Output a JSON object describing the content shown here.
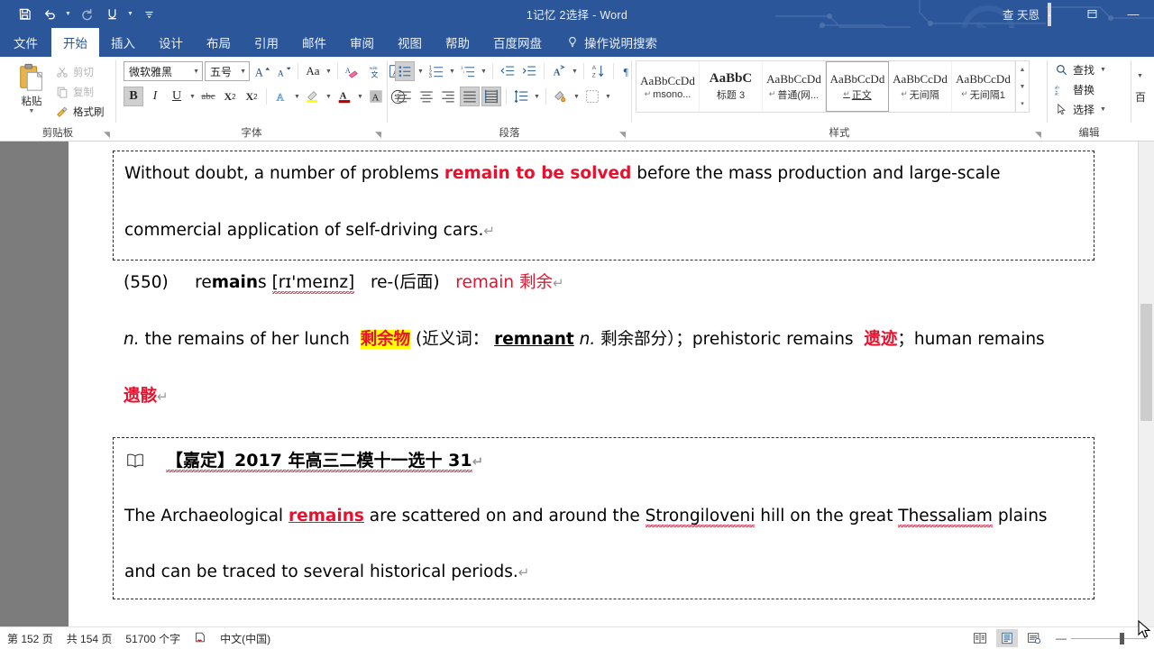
{
  "titlebar": {
    "document_title": "1记忆 2选择  -  Word",
    "account_name": "查 天恩",
    "quick_access": [
      {
        "name": "save",
        "icon": "save-icon"
      },
      {
        "name": "undo",
        "icon": "undo-icon"
      },
      {
        "name": "redo",
        "icon": "redo-icon"
      },
      {
        "name": "underline",
        "icon": "underline-icon"
      },
      {
        "name": "customize",
        "icon": "customize-toolbar-icon"
      }
    ],
    "window_controls": {
      "ribbon_display": "⊡",
      "minimize": "—"
    }
  },
  "tabs": [
    {
      "label": "文件",
      "active": false
    },
    {
      "label": "开始",
      "active": true
    },
    {
      "label": "插入",
      "active": false
    },
    {
      "label": "设计",
      "active": false
    },
    {
      "label": "布局",
      "active": false
    },
    {
      "label": "引用",
      "active": false
    },
    {
      "label": "邮件",
      "active": false
    },
    {
      "label": "审阅",
      "active": false
    },
    {
      "label": "视图",
      "active": false
    },
    {
      "label": "帮助",
      "active": false
    },
    {
      "label": "百度网盘",
      "active": false
    }
  ],
  "tell_me": "操作说明搜索",
  "ribbon": {
    "clipboard": {
      "label": "剪贴板",
      "paste": "粘贴",
      "cut": "剪切",
      "copy": "复制",
      "format_painter": "格式刷"
    },
    "font": {
      "label": "字体",
      "font_name": "微软雅黑",
      "font_size": "五号",
      "grow": "A",
      "shrink": "A",
      "change_case": "Aa",
      "clear_format": "clear-formatting-icon",
      "phonetic": "拼音指南",
      "char_border": "A",
      "bold": "B",
      "italic": "I",
      "underline": "U",
      "strikethrough": "abc",
      "subscript": "X",
      "superscript": "X",
      "text_effects": "A",
      "highlight": "highlight-icon",
      "font_color": "A",
      "shading_char": "A",
      "enclose_char": "字"
    },
    "paragraph": {
      "label": "段落",
      "bullets": "bullet-list-icon",
      "numbering": "numbered-list-icon",
      "multilevel": "multilevel-list-icon",
      "decrease_indent": "decrease-indent-icon",
      "increase_indent": "increase-indent-icon",
      "asian_layout": "asian-layout-icon",
      "sort": "sort-icon",
      "show_marks": "show-formatting-marks-icon",
      "align_left": "align-left-icon",
      "align_center": "align-center-icon",
      "align_right": "align-right-icon",
      "justify": "justify-icon",
      "distribute": "distribute-icon",
      "line_spacing": "line-spacing-icon",
      "shading": "shading-icon",
      "borders": "borders-icon"
    },
    "styles": {
      "label": "样式",
      "items": [
        {
          "preview": "AaBbCcDd",
          "name": "msono...",
          "bold": false,
          "selected": false,
          "pilcrow": true
        },
        {
          "preview": "AaBbC",
          "name": "标题 3",
          "bold": true,
          "selected": false,
          "pilcrow": false
        },
        {
          "preview": "AaBbCcDd",
          "name": "普通(网...",
          "bold": false,
          "selected": false,
          "pilcrow": true
        },
        {
          "preview": "AaBbCcDd",
          "name": "正文",
          "bold": false,
          "selected": true,
          "pilcrow": true
        },
        {
          "preview": "AaBbCcDd",
          "name": "无间隔",
          "bold": false,
          "selected": false,
          "pilcrow": true
        },
        {
          "preview": "AaBbCcDd",
          "name": "无间隔1",
          "bold": false,
          "selected": false,
          "pilcrow": true
        }
      ]
    },
    "editing": {
      "label": "编辑",
      "find": "查找",
      "replace": "替换",
      "select": "选择"
    },
    "partial_right": "百"
  },
  "document": {
    "block1": {
      "line1_a": "Without  doubt,  a  number  of  problems  ",
      "line1_red": "remain  to  be  solved",
      "line1_b": "  before  the  mass  production  and  large-scale",
      "line2": "commercial  application  of  self-driving  cars.",
      "pilcrow": "↵"
    },
    "entry": {
      "number": "(550)",
      "word_pre": "re",
      "word_bold": "main",
      "word_post": "s",
      "phonetic": "[rɪ'meɪnz]",
      "prefix_note": "re-(后面)",
      "root": "remain",
      "meaning": "剩余",
      "pilcrow": "↵"
    },
    "definition": {
      "pos": "n.",
      "seg1": "the remains of her lunch",
      "gloss1": "剩余物",
      "seg2": "(近义词：",
      "synonym": "remnant",
      "syn_pos": "n.",
      "syn_gloss": "剩余部分）；",
      "seg3": "prehistoric remains",
      "gloss2": "遗迹",
      "seg4": "；human remains",
      "gloss3": "遗骸",
      "pilcrow": "↵"
    },
    "example": {
      "source_icon": "book-icon",
      "source": "【嘉定】2017 年高三二模十一选十 31",
      "source_pilcrow": "↵",
      "sent_a": "The Archaeological ",
      "sent_key": "remains",
      "sent_b": " are scattered on and around the ",
      "sent_sp1": "Strongiloveni",
      "sent_c": " hill on the great ",
      "sent_sp2": "Thessaliam",
      "sent_d": " plains",
      "sent_line2": "and can be traced to several historical periods.",
      "pilcrow": "↵"
    }
  },
  "statusbar": {
    "page": "第 152 页",
    "total": "共 154 页",
    "words": "51700 个字",
    "proofing_icon": "proofing-errors-icon",
    "language": "中文(中国)",
    "views": [
      {
        "name": "read-mode",
        "active": false
      },
      {
        "name": "print-layout",
        "active": true
      },
      {
        "name": "web-layout",
        "active": false
      }
    ],
    "zoom_minus": "—",
    "zoom_plus": ""
  },
  "colors": {
    "brand": "#2b579a",
    "accent_red": "#e8112d",
    "highlight": "#ffff00",
    "doc_bg": "#7c7c7c"
  }
}
